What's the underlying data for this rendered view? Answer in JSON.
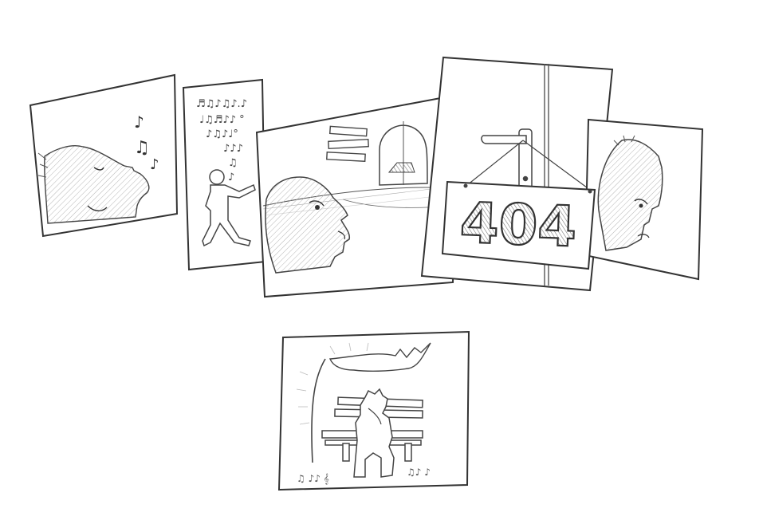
{
  "comic": {
    "panels": [
      {
        "id": "whistling-face",
        "description_icon": "music-note-icon"
      },
      {
        "id": "walking-person",
        "description_icon": "music-note-icon"
      },
      {
        "id": "looking-up",
        "description_icon": "signpost-icon"
      },
      {
        "id": "door-sign",
        "description_icon": "door-handle-icon"
      },
      {
        "id": "sad-face",
        "description_icon": "face-icon"
      },
      {
        "id": "bench-sitting",
        "description_icon": "bench-icon"
      }
    ],
    "sign_text": "404",
    "colors": {
      "ink": "#333333",
      "hatch": "#9a9a9a",
      "sign_fill": "#666666",
      "background": "#ffffff"
    }
  }
}
